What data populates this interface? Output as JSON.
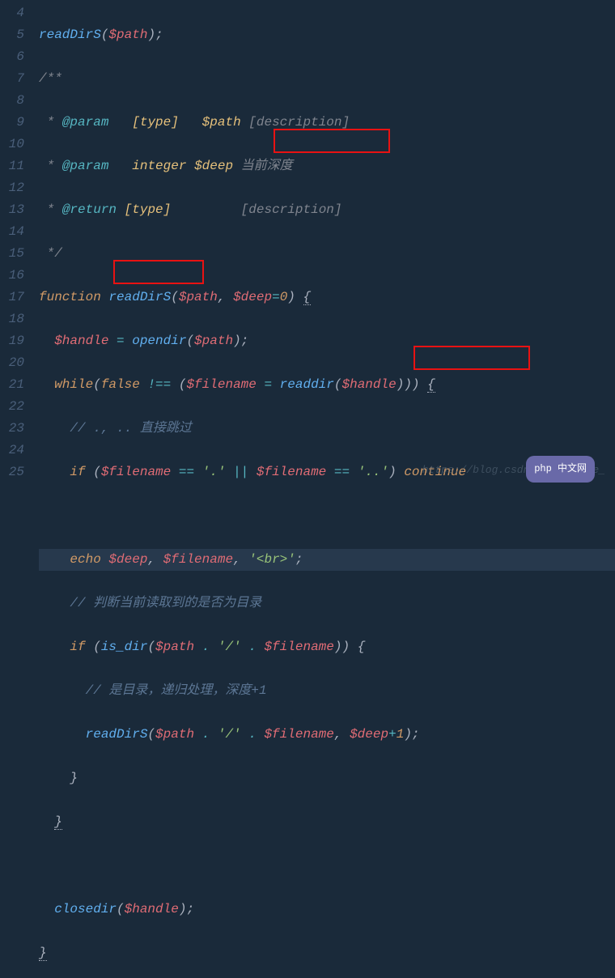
{
  "gutter": {
    "start": 4,
    "end": 25
  },
  "code": {
    "l4": {
      "fn": "readDirS",
      "p1": "(",
      "var": "$path",
      "p2": ");"
    },
    "l5": {
      "cmt": "/**"
    },
    "l6": {
      "star": " * ",
      "tag": "@param",
      "sp1": "   ",
      "type": "[type]",
      "sp2": "   ",
      "var": "$path",
      "desc": " [description]"
    },
    "l7": {
      "star": " * ",
      "tag": "@param",
      "sp1": "   ",
      "type": "integer",
      "sp2": " ",
      "var": "$deep",
      "desc": " 当前深度"
    },
    "l8": {
      "star": " * ",
      "tag": "@return",
      "sp1": " ",
      "type": "[type]",
      "pad": "         ",
      "desc": "[description]"
    },
    "l9": {
      "cmt": " */"
    },
    "l10": {
      "kw": "function",
      "fn": " readDirS",
      "p1": "(",
      "v1": "$path",
      "c": ", ",
      "v2": "$deep",
      "eq": "=",
      "num": "0",
      "p2": ") ",
      "br": "{"
    },
    "l11": {
      "v1": "$handle ",
      "eq": "= ",
      "fn": "opendir",
      "p1": "(",
      "v2": "$path",
      "p2": ");"
    },
    "l12": {
      "kw": "while",
      "p1": "(",
      "kwf": "false ",
      "neq": "!==",
      "p2": " (",
      "v1": "$filename ",
      "eq": "= ",
      "fn": "readdir",
      "p3": "(",
      "v2": "$handle",
      "p4": "))) ",
      "br": "{"
    },
    "l13": {
      "cmt": "// ., .. 直接跳过"
    },
    "l14": {
      "kw": "if ",
      "p1": "(",
      "v1": "$filename ",
      "eq1": "==",
      "s1": " '.' ",
      "or": "||",
      "v2": " $filename ",
      "eq2": "==",
      "s2": " '..'",
      "p2": ") ",
      "cont": "continue"
    },
    "l16": {
      "kw": "echo ",
      "v1": "$deep",
      "c1": ", ",
      "v2": "$filename",
      "c2": ", ",
      "s": "'<br>'",
      "semi": ";"
    },
    "l17": {
      "cmt": "// 判断当前读取到的是否为目录"
    },
    "l18": {
      "kw": "if ",
      "p1": "(",
      "fn": "is_dir",
      "p2": "(",
      "v1": "$path ",
      "dot1": ". ",
      "s1": "'/' ",
      "dot2": ". ",
      "v2": "$filename",
      "p3": ")) ",
      "br": "{"
    },
    "l19": {
      "cmt": "// 是目录，递归处理，深度+1"
    },
    "l20": {
      "fn": "readDirS",
      "p1": "(",
      "v1": "$path ",
      "dot1": ". ",
      "s1": "'/' ",
      "dot2": ". ",
      "v2": "$filename",
      "c": ", ",
      "v3": "$deep",
      "plus": "+",
      "n": "1",
      "p2": ");"
    },
    "l21": {
      "br": "}"
    },
    "l22": {
      "br": "}"
    },
    "l24": {
      "fn": "closedir",
      "p1": "(",
      "v": "$handle",
      "p2": ");"
    },
    "l25": {
      "br": "}"
    }
  },
  "watermark": "https://blog.csdn.net/change_",
  "phplogo": "php 中文网"
}
